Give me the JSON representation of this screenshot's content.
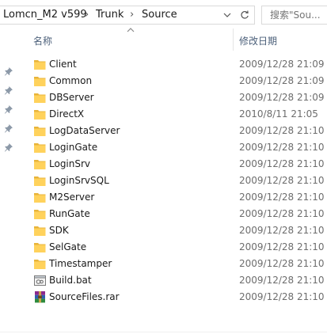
{
  "address": {
    "crumbs": [
      "Lomcn_M2 v599",
      "Trunk",
      "Source"
    ],
    "separator": "›",
    "dropdown_icon": "chevron-down-icon",
    "refresh_icon": "refresh-icon"
  },
  "search": {
    "placeholder": "搜索\"Sou..."
  },
  "columns": {
    "name": "名称",
    "date_modified": "修改日期",
    "sort": "ascending"
  },
  "quick_access_pins": 5,
  "files": [
    {
      "name": "Client",
      "date": "2009/12/28 21:09",
      "type": "folder"
    },
    {
      "name": "Common",
      "date": "2009/12/28 21:09",
      "type": "folder"
    },
    {
      "name": "DBServer",
      "date": "2009/12/28 21:09",
      "type": "folder"
    },
    {
      "name": "DirectX",
      "date": "2010/8/11 21:05",
      "type": "folder"
    },
    {
      "name": "LogDataServer",
      "date": "2009/12/28 21:10",
      "type": "folder"
    },
    {
      "name": "LoginGate",
      "date": "2009/12/28 21:10",
      "type": "folder"
    },
    {
      "name": "LoginSrv",
      "date": "2009/12/28 21:10",
      "type": "folder"
    },
    {
      "name": "LoginSrvSQL",
      "date": "2009/12/28 21:10",
      "type": "folder"
    },
    {
      "name": "M2Server",
      "date": "2009/12/28 21:10",
      "type": "folder"
    },
    {
      "name": "RunGate",
      "date": "2009/12/28 21:10",
      "type": "folder"
    },
    {
      "name": "SDK",
      "date": "2009/12/28 21:10",
      "type": "folder"
    },
    {
      "name": "SelGate",
      "date": "2009/12/28 21:10",
      "type": "folder"
    },
    {
      "name": "Timestamper",
      "date": "2009/12/28 21:10",
      "type": "folder"
    },
    {
      "name": "Build.bat",
      "date": "2009/12/28 21:10",
      "type": "batch-file"
    },
    {
      "name": "SourceFiles.rar",
      "date": "2009/12/28 21:10",
      "type": "rar-archive"
    }
  ],
  "colors": {
    "folder": "#ffd25c",
    "folder_dark": "#e8b43a",
    "header_text": "#4c607a",
    "date_text": "#6d6d6d"
  }
}
